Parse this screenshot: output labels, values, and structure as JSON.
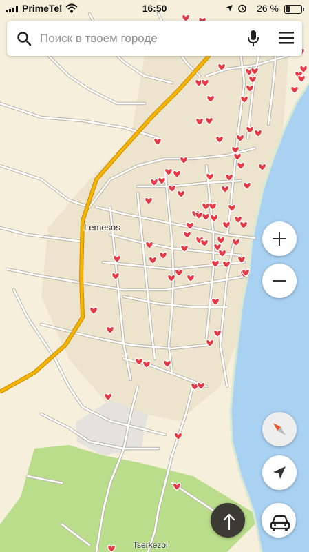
{
  "status_bar": {
    "carrier": "PrimeTel",
    "time": "16:50",
    "battery": "26 %",
    "battery_level": 0.26
  },
  "search": {
    "placeholder": "Поиск в твоем городе"
  },
  "map": {
    "labels": {
      "city": "Lemesos",
      "district": "Tserkezoi"
    },
    "colors": {
      "land": "#f6efdc",
      "urban": "#ece4cc",
      "road": "#ffffff",
      "road_casing": "#b9b4a6",
      "highway": "#f4b400",
      "sea": "#a9d1f2",
      "park": "#b9dd8a",
      "heart": "#e53945"
    },
    "heart_markers_count": 96
  },
  "controls": {
    "zoom_in": "+",
    "zoom_out": "−"
  }
}
